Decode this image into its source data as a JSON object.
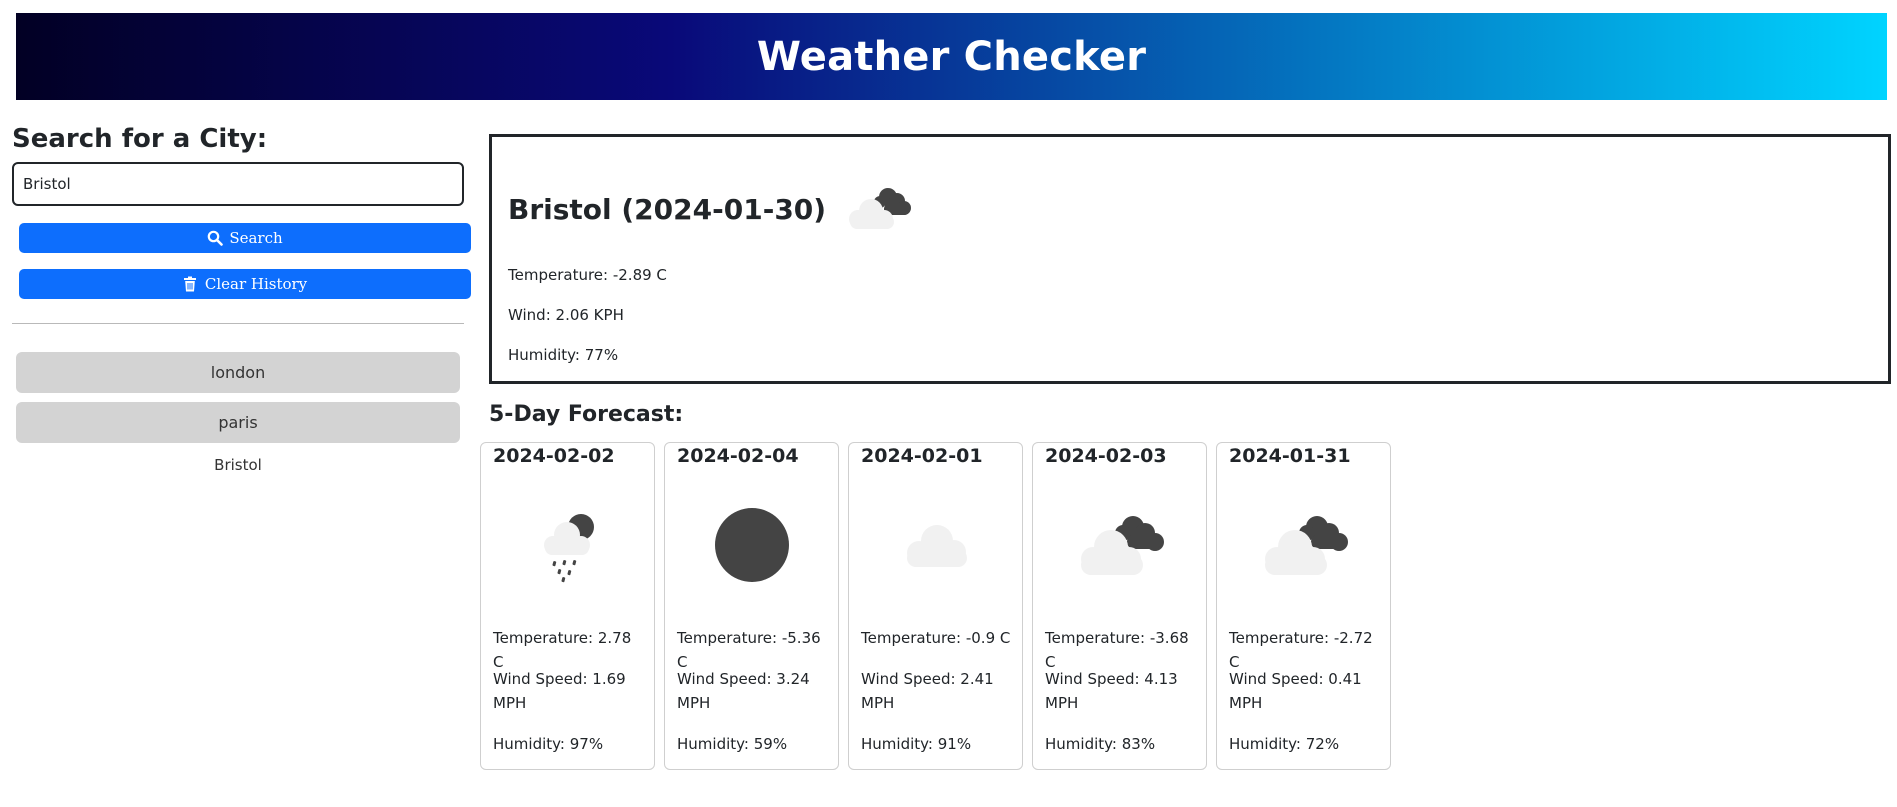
{
  "header": {
    "title": "Weather Checker"
  },
  "search": {
    "heading": "Search for a City:",
    "input_value": "Bristol",
    "search_label": "Search",
    "clear_label": "Clear History"
  },
  "history": [
    "london",
    "paris",
    "Bristol"
  ],
  "current": {
    "title": "Bristol (2024-01-30)",
    "icon": "partly-cloudy-night-icon",
    "temperature": "Temperature: -2.89 C",
    "wind": "Wind: 2.06 KPH",
    "humidity": "Humidity: 77%"
  },
  "forecast": {
    "heading": "5-Day Forecast:",
    "days": [
      {
        "date": "2024-02-02",
        "icon": "rain-night-icon",
        "temperature": "Temperature: 2.78 C",
        "wind": "Wind Speed: 1.69 MPH",
        "humidity": "Humidity: 97%"
      },
      {
        "date": "2024-02-04",
        "icon": "clear-night-icon",
        "temperature": "Temperature: -5.36 C",
        "wind": "Wind Speed: 3.24 MPH",
        "humidity": "Humidity: 59%"
      },
      {
        "date": "2024-02-01",
        "icon": "cloud-icon",
        "temperature": "Temperature: -0.9 C",
        "wind": "Wind Speed: 2.41 MPH",
        "humidity": "Humidity: 91%"
      },
      {
        "date": "2024-02-03",
        "icon": "partly-cloudy-night-icon",
        "temperature": "Temperature: -3.68 C",
        "wind": "Wind Speed: 4.13 MPH",
        "humidity": "Humidity: 83%"
      },
      {
        "date": "2024-01-31",
        "icon": "partly-cloudy-night-icon",
        "temperature": "Temperature: -2.72 C",
        "wind": "Wind Speed: 0.41 MPH",
        "humidity": "Humidity: 72%"
      }
    ]
  }
}
